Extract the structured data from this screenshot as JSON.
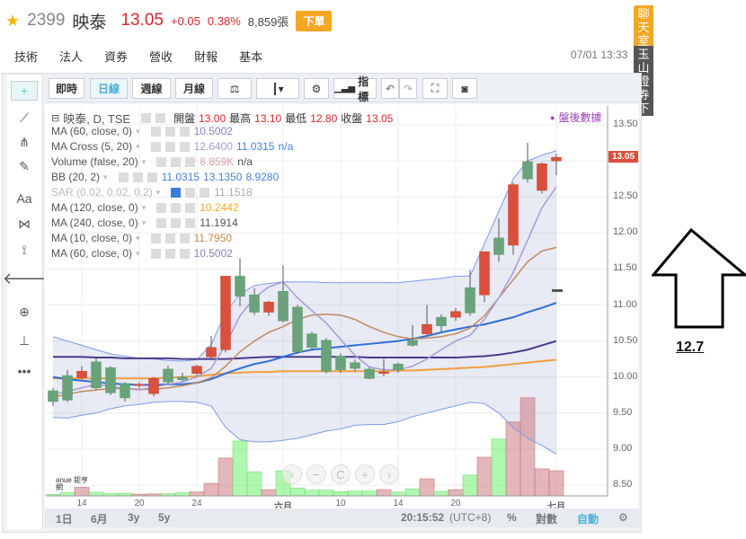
{
  "header": {
    "code": "2399",
    "name": "映泰",
    "price": "13.05",
    "change": "+0.05",
    "change_pct": "0.38%",
    "volume": "8,859張",
    "order_label": "下單"
  },
  "tabs": [
    "技術",
    "法人",
    "資券",
    "營收",
    "財報",
    "基本"
  ],
  "timestamp": "07/01 13:33",
  "side": {
    "chat": "聊天室",
    "broker": "玉山證券下單"
  },
  "toolbar": {
    "realtime": "即時",
    "daily": "日線",
    "weekly": "週線",
    "monthly": "月線",
    "indicators": "指標"
  },
  "legend": {
    "main": {
      "title": "映泰, D, TSE",
      "open_label": "開盤",
      "open": "13.00",
      "high_label": "最高",
      "high": "13.10",
      "low_label": "最低",
      "low": "12.80",
      "close_label": "收盤",
      "close": "13.05"
    },
    "after_hours": "盤後數據",
    "studies": [
      {
        "name": "MA (60, close, 0)",
        "values": [
          {
            "v": "10.5002",
            "c": "#8e7cc3"
          }
        ]
      },
      {
        "name": "MA Cross (5, 20)",
        "values": [
          {
            "v": "12.6400",
            "c": "#a89bd6"
          },
          {
            "v": "11.0315",
            "c": "#4a7fd8"
          },
          {
            "v": "n/a",
            "c": "#4a7fd8"
          }
        ]
      },
      {
        "name": "Volume (false, 20)",
        "values": [
          {
            "v": "8.859K",
            "c": "#e0a0a0"
          },
          {
            "v": "n/a",
            "c": "#555"
          }
        ]
      },
      {
        "name": "BB (20, 2)",
        "values": [
          {
            "v": "11.0315",
            "c": "#4a7fd8"
          },
          {
            "v": "13.1350",
            "c": "#4a7fd8"
          },
          {
            "v": "8.9280",
            "c": "#4a7fd8"
          }
        ]
      },
      {
        "name": "SAR (0.02, 0.02, 0.2)",
        "values": [
          {
            "v": "11.1518",
            "c": "#aaa"
          }
        ],
        "dim": true
      },
      {
        "name": "MA (120, close, 0)",
        "values": [
          {
            "v": "10.2442",
            "c": "#f5a623"
          }
        ]
      },
      {
        "name": "MA (240, close, 0)",
        "values": [
          {
            "v": "11.1914",
            "c": "#555"
          }
        ]
      },
      {
        "name": "MA (10, close, 0)",
        "values": [
          {
            "v": "11.7950",
            "c": "#c08a50"
          }
        ]
      },
      {
        "name": "MA (60, close, 0)",
        "values": [
          {
            "v": "10.5002",
            "c": "#8e7cc3"
          }
        ]
      }
    ]
  },
  "bottom_bar": {
    "ranges": [
      "1日",
      "6月",
      "3y",
      "5y"
    ],
    "clock": "20:15:52",
    "tz": "(UTC+8)",
    "pct": "%",
    "log": "對數",
    "auto": "自動"
  },
  "logo_text": "anue 鉅亨網",
  "annotation": "12.7",
  "chart_data": {
    "type": "candlestick",
    "price_axis": {
      "min": 8.5,
      "max": 13.5,
      "ticks": [
        "13.50",
        "13.00",
        "12.50",
        "12.00",
        "11.50",
        "11.00",
        "10.50",
        "10.00",
        "9.50",
        "9.00",
        "8.50"
      ]
    },
    "last_price_tag": "13.05",
    "x_ticks": [
      {
        "i": 2,
        "label": "14"
      },
      {
        "i": 6,
        "label": "20"
      },
      {
        "i": 10,
        "label": "24"
      },
      {
        "i": 16,
        "label": "六月",
        "bold": true
      },
      {
        "i": 20,
        "label": "10"
      },
      {
        "i": 24,
        "label": "14"
      },
      {
        "i": 28,
        "label": "20"
      },
      {
        "i": 35,
        "label": "七月",
        "bold": true
      }
    ],
    "ohlc": [
      [
        9.81,
        9.85,
        9.6,
        9.66
      ],
      [
        10.02,
        10.1,
        9.65,
        9.68
      ],
      [
        9.99,
        10.15,
        9.97,
        10.08
      ],
      [
        10.21,
        10.28,
        9.82,
        9.85
      ],
      [
        10.13,
        10.15,
        9.75,
        9.78
      ],
      [
        9.91,
        9.93,
        9.66,
        9.71
      ],
      [
        9.9,
        9.93,
        9.85,
        9.9
      ],
      [
        9.77,
        10.0,
        9.73,
        9.98
      ],
      [
        10.11,
        10.16,
        9.9,
        9.93
      ],
      [
        10.0,
        10.06,
        9.94,
        9.96
      ],
      [
        10.05,
        10.17,
        10.02,
        10.15
      ],
      [
        10.28,
        10.57,
        10.26,
        10.41
      ],
      [
        10.38,
        11.4,
        10.34,
        11.4
      ],
      [
        11.4,
        11.65,
        10.98,
        11.12
      ],
      [
        11.14,
        11.23,
        10.86,
        10.9
      ],
      [
        10.9,
        11.06,
        10.85,
        11.04
      ],
      [
        11.19,
        11.55,
        10.76,
        10.78
      ],
      [
        10.97,
        11.0,
        10.32,
        10.35
      ],
      [
        10.6,
        10.63,
        10.38,
        10.41
      ],
      [
        10.51,
        10.54,
        10.05,
        10.08
      ],
      [
        10.29,
        10.33,
        10.06,
        10.1
      ],
      [
        10.2,
        10.24,
        10.08,
        10.12
      ],
      [
        10.11,
        10.14,
        9.97,
        9.98
      ],
      [
        10.05,
        10.25,
        10.01,
        10.07
      ],
      [
        10.18,
        10.2,
        10.06,
        10.1
      ],
      [
        10.51,
        10.72,
        10.42,
        10.44
      ],
      [
        10.6,
        11.0,
        10.56,
        10.73
      ],
      [
        10.83,
        10.87,
        10.62,
        10.71
      ],
      [
        10.83,
        10.96,
        10.78,
        10.91
      ],
      [
        11.24,
        11.49,
        10.85,
        10.89
      ],
      [
        11.14,
        11.74,
        11.04,
        11.74
      ],
      [
        11.93,
        12.2,
        11.6,
        11.7
      ],
      [
        11.83,
        12.7,
        11.7,
        12.67
      ],
      [
        12.99,
        13.25,
        12.7,
        12.75
      ],
      [
        12.59,
        12.98,
        12.55,
        12.96
      ],
      [
        13.0,
        13.1,
        12.8,
        13.05
      ]
    ],
    "volume": [
      {
        "v": 500,
        "up": false
      },
      {
        "v": 1200,
        "up": false
      },
      {
        "v": 3000,
        "up": true
      },
      {
        "v": 1300,
        "up": false
      },
      {
        "v": 800,
        "up": false
      },
      {
        "v": 900,
        "up": false
      },
      {
        "v": 600,
        "up": true
      },
      {
        "v": 700,
        "up": true
      },
      {
        "v": 800,
        "up": false
      },
      {
        "v": 1100,
        "up": false
      },
      {
        "v": 1400,
        "up": true
      },
      {
        "v": 4400,
        "up": true
      },
      {
        "v": 13300,
        "up": true
      },
      {
        "v": 19300,
        "up": false
      },
      {
        "v": 8500,
        "up": false
      },
      {
        "v": 2200,
        "up": true
      },
      {
        "v": 8800,
        "up": false
      },
      {
        "v": 2800,
        "up": false
      },
      {
        "v": 2000,
        "up": false
      },
      {
        "v": 2000,
        "up": false
      },
      {
        "v": 1500,
        "up": false
      },
      {
        "v": 1700,
        "up": false
      },
      {
        "v": 1700,
        "up": false
      },
      {
        "v": 2200,
        "up": true
      },
      {
        "v": 1300,
        "up": false
      },
      {
        "v": 2500,
        "up": false
      },
      {
        "v": 6000,
        "up": true
      },
      {
        "v": 1600,
        "up": false
      },
      {
        "v": 2200,
        "up": true
      },
      {
        "v": 7300,
        "up": false
      },
      {
        "v": 13600,
        "up": true
      },
      {
        "v": 20000,
        "up": false
      },
      {
        "v": 26000,
        "up": true
      },
      {
        "v": 34500,
        "up": true
      },
      {
        "v": 9500,
        "up": true
      },
      {
        "v": 8859,
        "up": true
      }
    ],
    "series": [
      {
        "name": "BB upper",
        "color": "#7a9be8",
        "width": 1,
        "values": [
          10.56,
          10.5,
          10.44,
          10.38,
          10.32,
          10.29,
          10.26,
          10.25,
          10.23,
          10.22,
          10.24,
          10.45,
          10.9,
          11.15,
          11.27,
          11.3,
          11.32,
          11.32,
          11.32,
          11.31,
          11.31,
          11.31,
          11.31,
          11.31,
          11.31,
          11.33,
          11.35,
          11.37,
          11.4,
          11.4,
          11.85,
          12.3,
          12.75,
          13.0,
          13.08,
          13.14
        ]
      },
      {
        "name": "BB lower",
        "color": "#7a9be8",
        "width": 1,
        "values": [
          9.44,
          9.43,
          9.47,
          9.5,
          9.56,
          9.6,
          9.62,
          9.65,
          9.66,
          9.66,
          9.65,
          9.6,
          9.3,
          9.13,
          9.1,
          9.1,
          9.12,
          9.15,
          9.2,
          9.25,
          9.28,
          9.33,
          9.34,
          9.34,
          9.38,
          9.45,
          9.5,
          9.55,
          9.6,
          9.65,
          9.63,
          9.5,
          9.3,
          9.15,
          9.05,
          8.93
        ]
      },
      {
        "name": "MA120",
        "color": "#f0a040",
        "width": 2,
        "values": [
          9.98,
          9.98,
          9.98,
          9.98,
          9.98,
          9.98,
          9.98,
          9.98,
          9.99,
          10.0,
          10.01,
          10.03,
          10.05,
          10.06,
          10.07,
          10.07,
          10.08,
          10.08,
          10.08,
          10.08,
          10.08,
          10.08,
          10.08,
          10.08,
          10.09,
          10.09,
          10.1,
          10.11,
          10.12,
          10.13,
          10.14,
          10.16,
          10.18,
          10.2,
          10.22,
          10.24
        ]
      },
      {
        "name": "MA240",
        "color": "#4b3a8c",
        "width": 2,
        "values": [
          10.28,
          10.28,
          10.28,
          10.27,
          10.27,
          10.26,
          10.26,
          10.26,
          10.26,
          10.25,
          10.25,
          10.25,
          10.25,
          10.26,
          10.27,
          10.28,
          10.28,
          10.28,
          10.28,
          10.28,
          10.28,
          10.28,
          10.27,
          10.27,
          10.27,
          10.27,
          10.27,
          10.27,
          10.27,
          10.28,
          10.29,
          10.31,
          10.34,
          10.38,
          10.44,
          10.5
        ]
      },
      {
        "name": "MA20",
        "color": "#2f6fd8",
        "width": 2,
        "values": [
          10.0,
          9.97,
          9.95,
          9.93,
          9.91,
          9.9,
          9.89,
          9.89,
          9.9,
          9.9,
          9.92,
          9.97,
          10.05,
          10.12,
          10.18,
          10.22,
          10.28,
          10.34,
          10.38,
          10.4,
          10.42,
          10.44,
          10.46,
          10.48,
          10.5,
          10.53,
          10.57,
          10.62,
          10.66,
          10.7,
          10.73,
          10.78,
          10.83,
          10.9,
          10.96,
          11.03
        ]
      },
      {
        "name": "MA10",
        "color": "#c08a60",
        "width": 1.5,
        "values": [
          9.72,
          9.76,
          9.8,
          9.82,
          9.84,
          9.84,
          9.83,
          9.83,
          9.85,
          9.88,
          9.92,
          9.99,
          10.15,
          10.35,
          10.5,
          10.62,
          10.7,
          10.8,
          10.86,
          10.87,
          10.86,
          10.8,
          10.7,
          10.62,
          10.56,
          10.53,
          10.54,
          10.56,
          10.6,
          10.68,
          10.85,
          11.1,
          11.35,
          11.6,
          11.75,
          11.8
        ]
      },
      {
        "name": "MA5",
        "color": "#a89bd6",
        "width": 1.5,
        "values": [
          9.76,
          9.8,
          9.85,
          9.9,
          9.87,
          9.84,
          9.82,
          9.86,
          9.9,
          9.93,
          10.0,
          10.12,
          10.45,
          10.85,
          11.1,
          11.25,
          11.32,
          11.1,
          10.92,
          10.75,
          10.52,
          10.3,
          10.14,
          10.1,
          10.1,
          10.15,
          10.25,
          10.38,
          10.5,
          10.58,
          10.8,
          11.1,
          11.45,
          11.9,
          12.35,
          12.64
        ]
      }
    ]
  }
}
